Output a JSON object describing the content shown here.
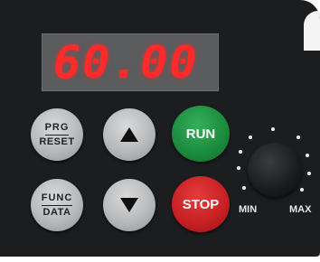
{
  "display": {
    "value": "60.00"
  },
  "buttons": {
    "prg_reset": {
      "top": "PRG",
      "bottom": "RESET"
    },
    "func_data": {
      "top": "FUNC",
      "bottom": "DATA"
    },
    "up": {
      "icon": "arrow-up-icon"
    },
    "down": {
      "icon": "arrow-down-icon"
    },
    "run": {
      "label": "RUN"
    },
    "stop": {
      "label": "STOP"
    }
  },
  "knob": {
    "min_label": "MIN",
    "max_label": "MAX"
  },
  "colors": {
    "panel": "#1b1d1f",
    "display_text": "#ff2a2a",
    "run": "#1b8a3c",
    "stop": "#c41f22"
  }
}
